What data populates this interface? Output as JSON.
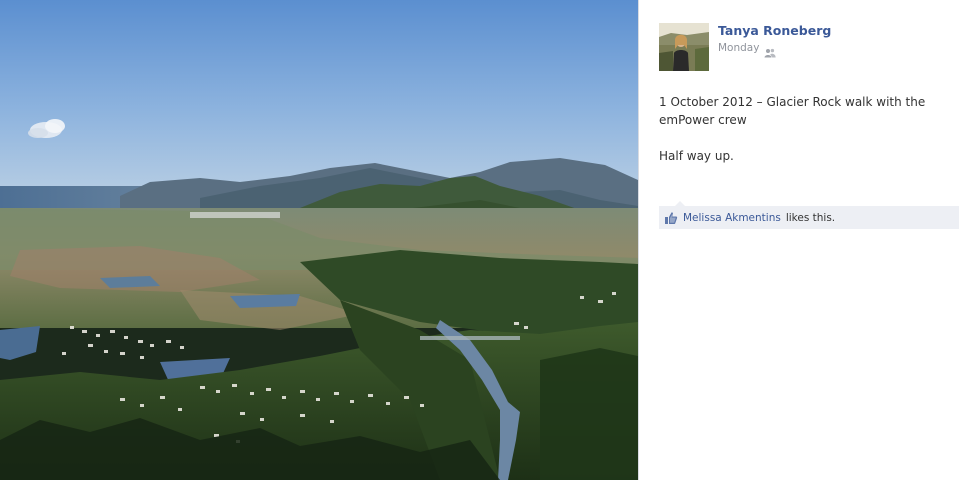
{
  "post": {
    "author": "Tanya Roneberg",
    "timestamp": "Monday",
    "audience_icon": "friends-icon",
    "caption_lines": [
      "1 October 2012 – Glacier Rock walk with the emPower crew",
      "Half way up."
    ]
  },
  "likes": {
    "icon": "thumbs-up-icon",
    "liker": "Melissa Akmentins",
    "suffix": "likes this."
  },
  "photo": {
    "subject": "aerial-landscape-photo"
  },
  "colors": {
    "link": "#3b5998",
    "muted": "#90949c",
    "likes_bg": "#edeff4",
    "text": "#333333"
  }
}
